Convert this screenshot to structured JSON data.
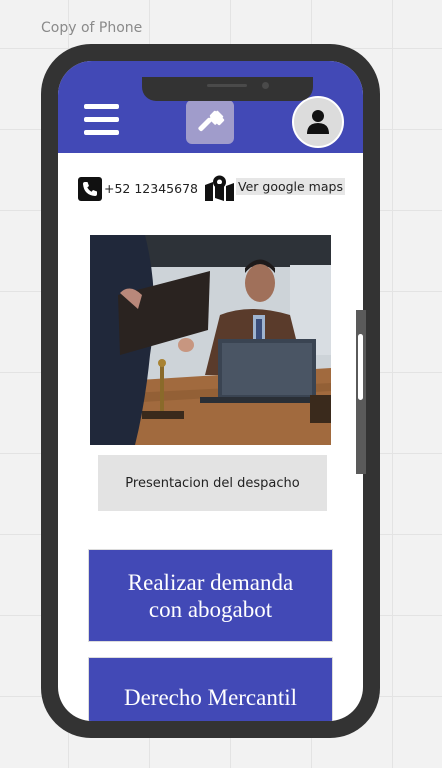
{
  "canvas": {
    "frame_label": "Copy of Phone"
  },
  "appbar": {
    "menu_icon": "hamburger-menu-icon",
    "logo_icon": "gavel-icon",
    "profile_icon": "user-icon",
    "color": "#4249b6"
  },
  "contact": {
    "phone_icon": "phone-square-icon",
    "phone": "+52 12345678",
    "maps_icon": "map-marker-icon",
    "maps_label": "Ver google maps"
  },
  "hero": {
    "image": "photo of lawyer seated at desk with laptop"
  },
  "presentation": {
    "label": "Presentacion del despacho"
  },
  "actions": [
    {
      "label": "Realizar demanda con abogabot"
    },
    {
      "label": "Derecho Mercantil"
    }
  ]
}
